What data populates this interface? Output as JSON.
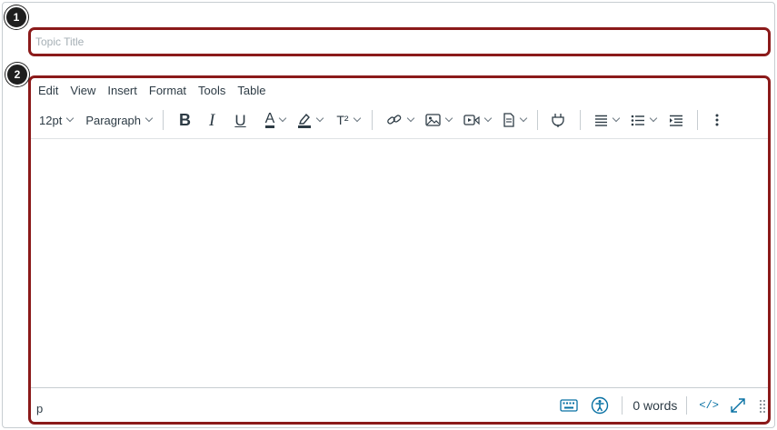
{
  "title_field": {
    "placeholder": "Topic Title",
    "value": ""
  },
  "menubar": {
    "items": [
      "Edit",
      "View",
      "Insert",
      "Format",
      "Tools",
      "Table"
    ]
  },
  "toolbar": {
    "font_size": "12pt",
    "block_format": "Paragraph",
    "superscript_label": "T²"
  },
  "statusbar": {
    "path": "p",
    "word_count": "0 words",
    "html_toggle": "</>"
  },
  "callouts": {
    "one": "1",
    "two": "2"
  },
  "colors": {
    "callout_border": "#8b1a1a",
    "accent": "#0770a3",
    "text": "#2d3b45"
  }
}
